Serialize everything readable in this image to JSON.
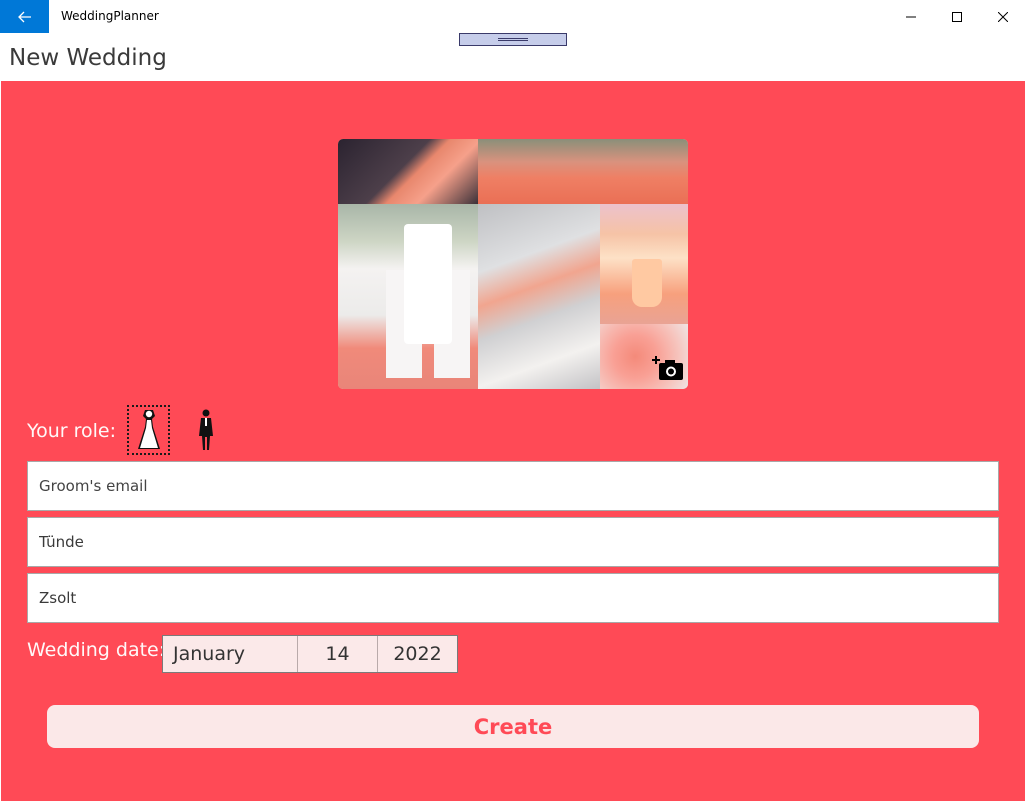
{
  "window": {
    "app_title": "WeddingPlanner",
    "back_icon": "arrow-left-icon",
    "minimize_icon": "minimize-icon",
    "maximize_icon": "maximize-icon",
    "close_icon": "close-icon"
  },
  "header": {
    "title": "New Wedding"
  },
  "photo": {
    "camera_icon": "add-photo-camera-icon"
  },
  "role": {
    "label": "Your role:",
    "options": [
      {
        "icon": "bride-icon",
        "selected": true
      },
      {
        "icon": "groom-icon",
        "selected": false
      }
    ]
  },
  "form": {
    "email_placeholder": "Groom's email",
    "email_value": "",
    "bride_name": "Tünde",
    "groom_name": "Zsolt"
  },
  "date": {
    "label": "Wedding date:",
    "month": "January",
    "day": "14",
    "year": "2022"
  },
  "actions": {
    "create_label": "Create"
  },
  "colors": {
    "accent": "#ff4a56",
    "back_button": "#0078d7",
    "button_bg": "#fbe8e8"
  }
}
